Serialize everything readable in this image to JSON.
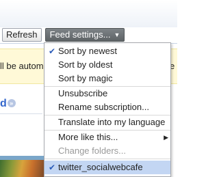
{
  "toolbar": {
    "refresh_label": "Refresh",
    "feed_settings_label": "Feed settings...",
    "feed_settings_caret": "▼"
  },
  "notice": {
    "text_left": "ll be autom",
    "text_right": "e"
  },
  "feed": {
    "title_fragment": "d",
    "badge_glyph": "»"
  },
  "menu": {
    "items": [
      {
        "label": "Sort by newest",
        "checked": true
      },
      {
        "label": "Sort by oldest"
      },
      {
        "label": "Sort by magic"
      },
      {
        "label": "Unsubscribe"
      },
      {
        "label": "Rename subscription..."
      },
      {
        "label": "Translate into my language"
      },
      {
        "label": "More like this...",
        "submenu": true
      },
      {
        "label": "Change folders...",
        "disabled": true
      },
      {
        "label": "twitter_socialwebcafe",
        "checked": true,
        "highlighted": true
      }
    ],
    "check_glyph": "✔",
    "submenu_glyph": "▶"
  },
  "colors": {
    "link_blue": "#3366cc",
    "notice_yellow": "#fff9d7",
    "highlight_blue": "#c3d6f3",
    "feed_button_gray": "#6c7174"
  }
}
